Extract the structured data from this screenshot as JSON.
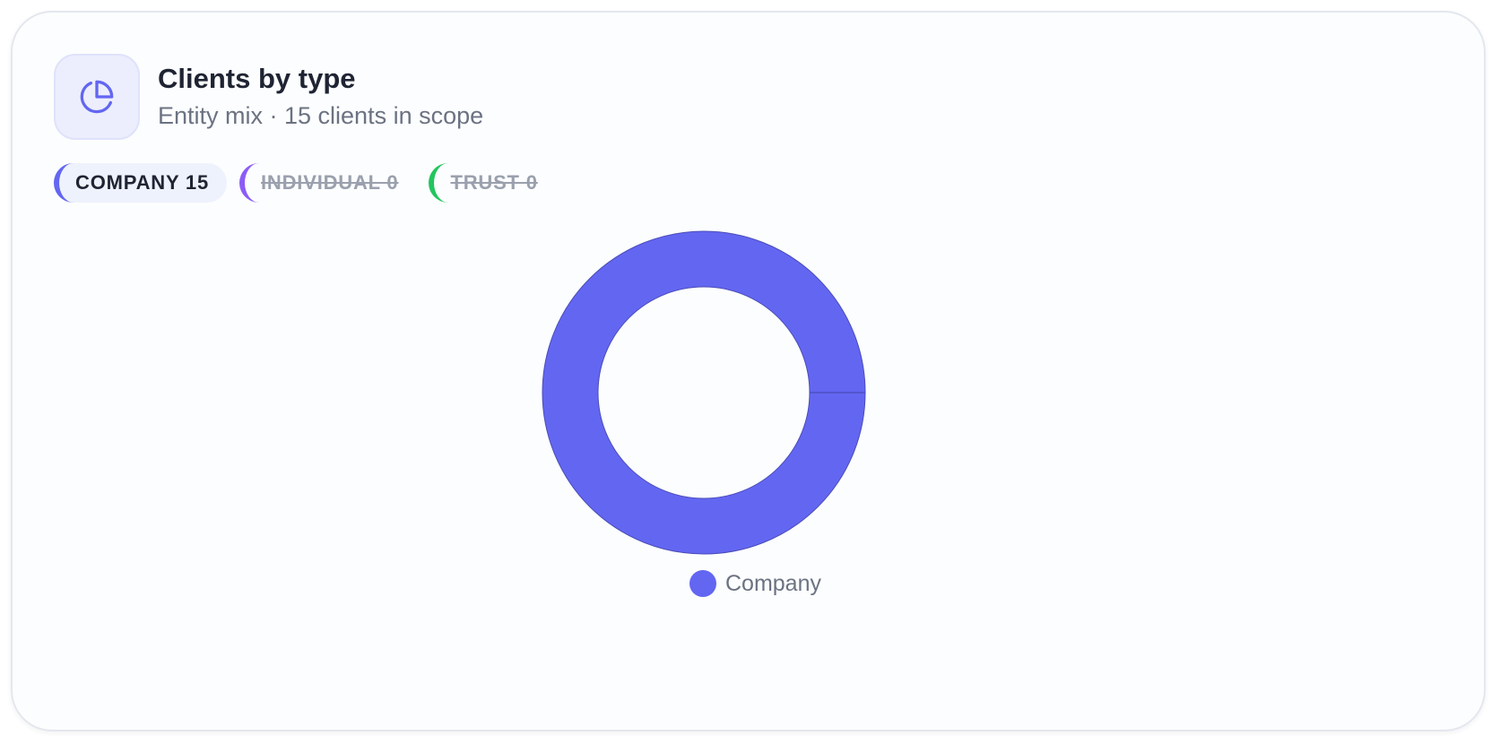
{
  "card": {
    "title": "Clients by type",
    "subtitle": "Entity mix · 15 clients in scope",
    "icon": "pie-chart-icon"
  },
  "chips": [
    {
      "label": "COMPANY 15",
      "color": "#6366f1",
      "active": true
    },
    {
      "label": "INDIVIDUAL 0",
      "color": "#8b5cf6",
      "active": false
    },
    {
      "label": "TRUST 0",
      "color": "#22c55e",
      "active": false
    }
  ],
  "colors": {
    "accent": "#6366f1",
    "icon_bg": "#eceefd"
  },
  "chart_data": {
    "type": "pie",
    "variant": "donut",
    "categories": [
      "Company",
      "Individual",
      "Trust"
    ],
    "values": [
      15,
      0,
      0
    ],
    "colors": [
      "#6366f1",
      "#8b5cf6",
      "#22c55e"
    ],
    "visible": [
      true,
      false,
      false
    ],
    "legend": {
      "placement": "bottom-center",
      "entries": [
        "Company"
      ]
    }
  }
}
